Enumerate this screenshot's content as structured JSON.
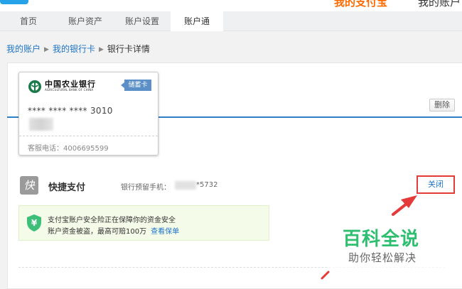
{
  "top": {
    "partial_left": "我的支付宝",
    "partial_right": "我的账户"
  },
  "nav": {
    "tabs": [
      {
        "label": "首页"
      },
      {
        "label": "账户资产"
      },
      {
        "label": "账户设置"
      },
      {
        "label": "账户通"
      }
    ]
  },
  "breadcrumb": {
    "items": [
      "我的账户",
      "我的银行卡",
      "银行卡详情"
    ],
    "separator": "▶"
  },
  "card": {
    "bank_name": "中国农业银行",
    "bank_name_en": "AGRICULTURAL BANK OF CHINA",
    "type_tag": "储蓄卡",
    "masked_number": "**** **** **** 3010",
    "service_phone": "客服电话：4006695599"
  },
  "actions": {
    "delete_label": "删除",
    "close_label": "关闭"
  },
  "quick_pay": {
    "icon_char": "快",
    "title": "快捷支付",
    "phone_label": "银行预留手机：",
    "phone_suffix": "*5732"
  },
  "insurance": {
    "line1": "支付宝账户安全险正在保障你的资金安全",
    "line2": "账户资金被盗，最高可赔100万",
    "link": "查看保单"
  },
  "watermark": {
    "title": "百科全说",
    "subtitle": "助你轻松解决"
  },
  "colors": {
    "accent_blue": "#2f7fc8",
    "link_blue": "#1e74c8",
    "highlight_red": "#e53a3a",
    "tag_blue": "#5b8fc7",
    "watermark_green": "#2dbf6f",
    "insurance_bg": "#f4fbe8",
    "shield_green": "#3dbf7a"
  }
}
